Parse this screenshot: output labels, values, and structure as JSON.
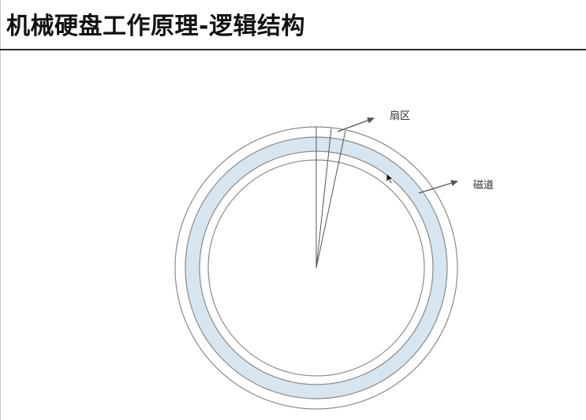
{
  "slide": {
    "title": "机械硬盘工作原理-逻辑结构"
  },
  "diagram": {
    "labels": {
      "sector": "扇区",
      "track": "磁道"
    },
    "colors": {
      "highlighted_track": "#d6e5ef",
      "ring_stroke": "#8a8a8a",
      "line": "#555555",
      "arrow": "#555555"
    }
  }
}
